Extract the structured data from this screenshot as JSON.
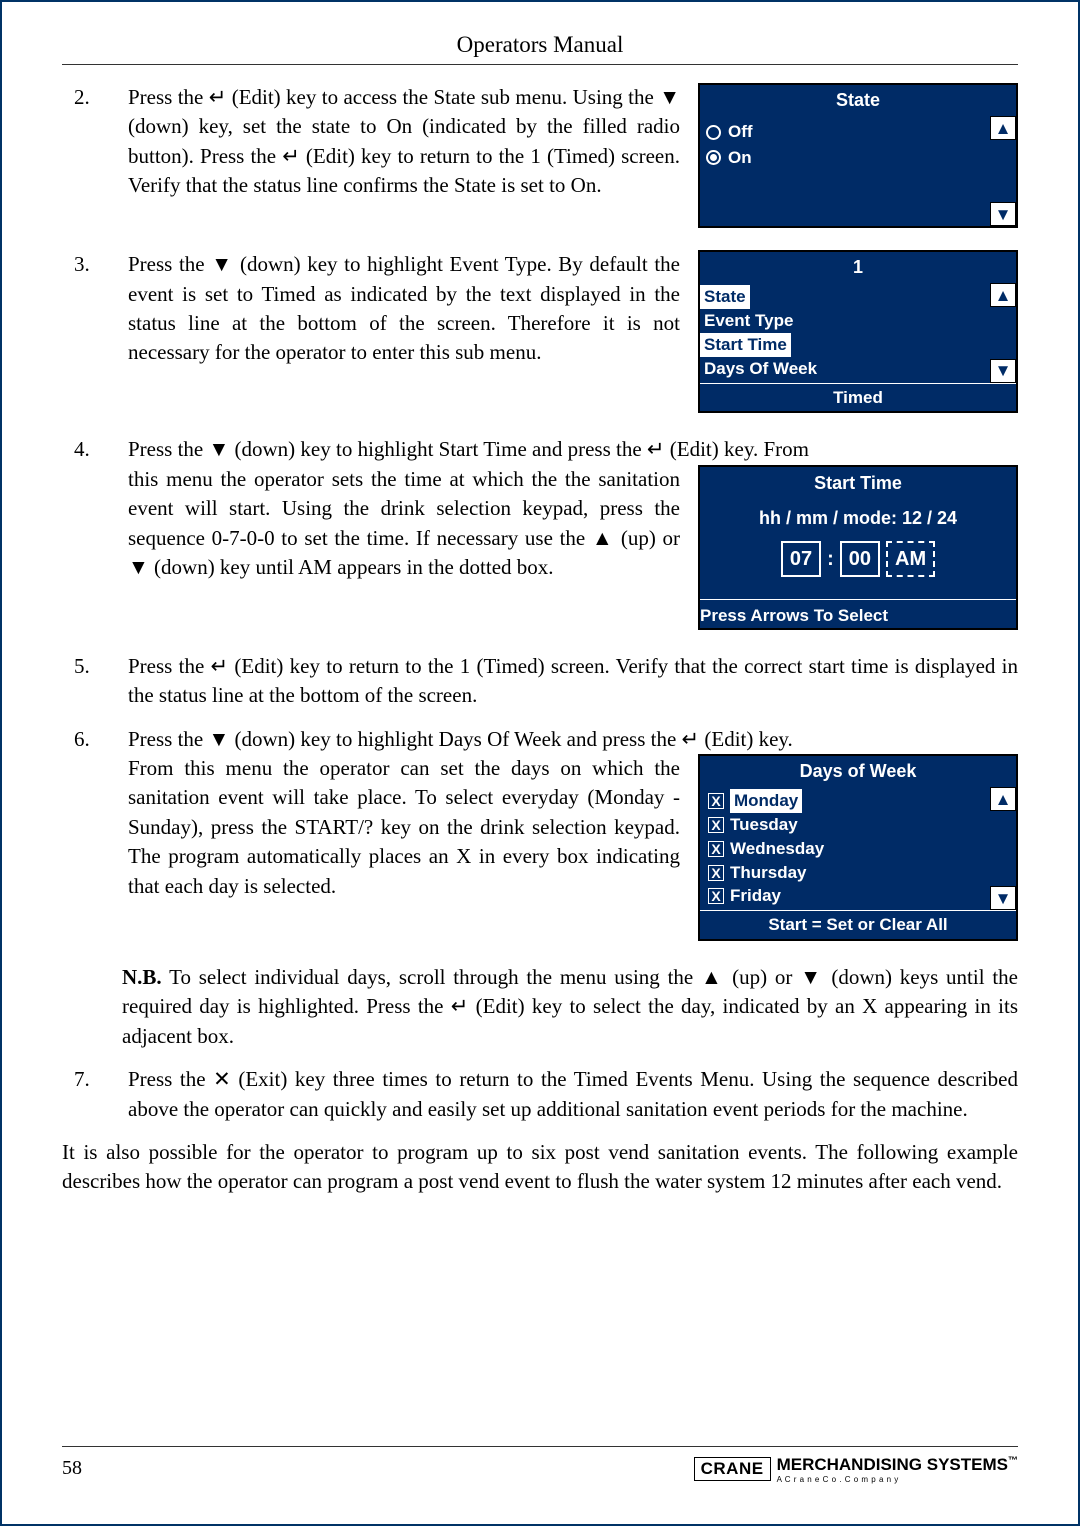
{
  "header": {
    "title": "Operators Manual"
  },
  "steps": {
    "s2": {
      "num": "2.",
      "text": "Press the ↵ (Edit) key to access the State sub menu. Using the ▼ (down) key, set the state to On (indicated by the filled radio button). Press the ↵ (Edit) key to return to the 1 (Timed) screen. Verify that the status line confirms the State is set to On."
    },
    "s3": {
      "num": "3.",
      "text": "Press the ▼ (down) key to highlight Event Type. By default the event is set to Timed as indicated by the text displayed in the status line at the bottom of the screen. Therefore it is not necessary for the operator to enter this sub menu."
    },
    "s4": {
      "num": "4.",
      "text_first": "Press the ▼ (down) key to highlight Start Time and press the ↵ (Edit) key. From",
      "text_rest": "this menu the operator sets the time at which the the sanitation event will start. Using the drink selection keypad, press the sequence 0-7-0-0 to set the time. If necessary use the ▲ (up) or ▼ (down) key until AM appears in the dotted box."
    },
    "s5": {
      "num": "5.",
      "text": "Press the ↵ (Edit) key to return to the 1 (Timed) screen. Verify that the correct start time is displayed in the status line at the bottom of the screen."
    },
    "s6": {
      "num": "6.",
      "text_first": "Press the ▼ (down) key to highlight Days Of Week and press the ↵ (Edit) key.",
      "text_rest": "From this menu the operator can set the days on which the sanitation event will take place. To select everyday (Monday - Sunday), press the START/? key on the drink selection keypad. The program automatically places an X in every box indicating that each day is selected."
    },
    "nb": {
      "label": "N.B.",
      "text": " To select individual days, scroll through the menu using the ▲ (up) or ▼ (down) keys until the required day is highlighted. Press the ↵ (Edit) key to select the day, indicated by an X appearing in its adjacent box."
    },
    "s7": {
      "num": "7.",
      "text": "Press the ✕ (Exit) key three times to return to the Timed Events Menu. Using the sequence described above the operator can quickly and easily set up additional sanitation event periods for the machine."
    },
    "closing": "It is also possible for the operator to program up to six post vend sanitation events. The following example describes how the operator can program a post vend event to flush the water system 12 minutes after each vend."
  },
  "panels": {
    "state": {
      "title": "State",
      "opt_off": "Off",
      "opt_on": "On"
    },
    "menu1": {
      "title": "1",
      "items": [
        "State",
        "Event Type",
        "Start Time",
        "Days Of Week"
      ],
      "status": "Timed"
    },
    "start_time": {
      "title": "Start Time",
      "format": "hh / mm / mode: 12 / 24",
      "hh": "07",
      "mm": "00",
      "mode": "AM",
      "footer": "Press Arrows To Select"
    },
    "days": {
      "title": "Days of Week",
      "items": [
        "Monday",
        "Tuesday",
        "Wednesday",
        "Thursday",
        "Friday"
      ],
      "footer": "Start = Set or Clear All",
      "check": "X"
    }
  },
  "icons": {
    "up": "▲",
    "down": "▼",
    "colon": ":"
  },
  "footer": {
    "page": "58",
    "brand1": "CRANE",
    "brand2": "MERCHANDISING SYSTEMS",
    "sub": "A  C r a n e  C o .  C o m p a n y",
    "tm": "™"
  }
}
